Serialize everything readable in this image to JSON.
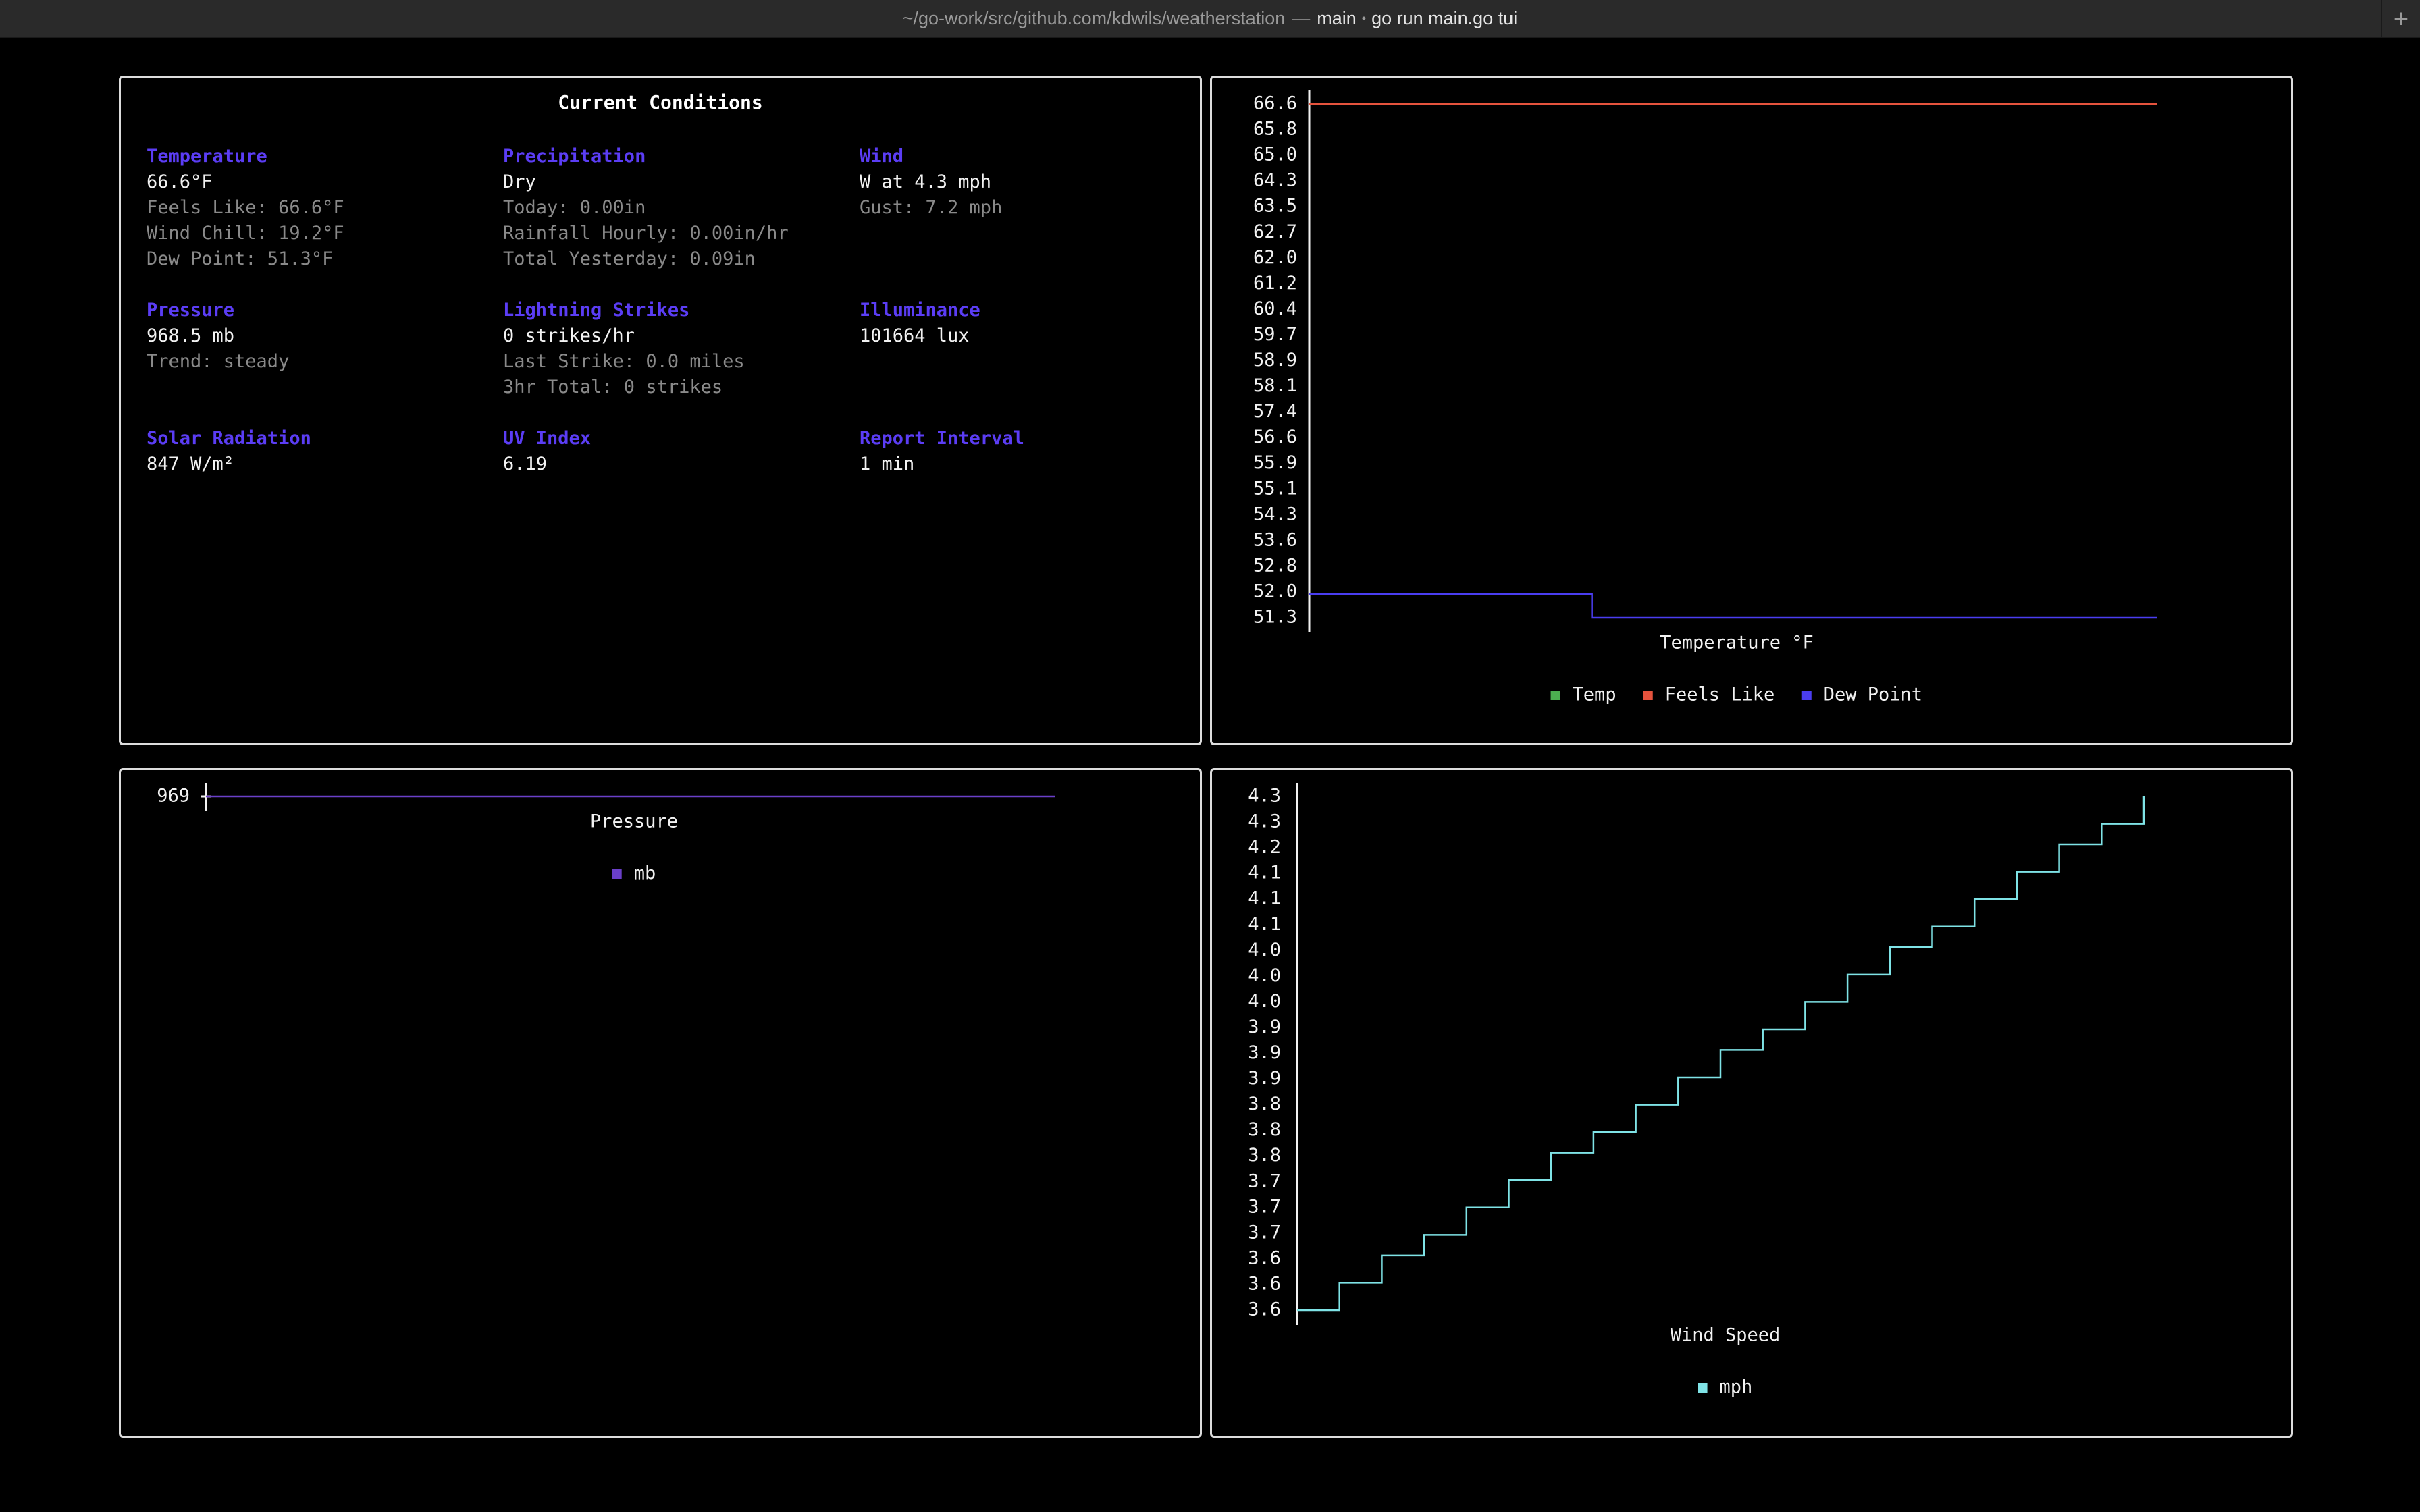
{
  "window": {
    "path": "~/go-work/src/github.com/kdwils/weatherstation",
    "separator": "—",
    "branch": "main",
    "dot": "•",
    "command": "go run main.go tui",
    "new_tab": "+"
  },
  "conditions": {
    "title": "Current Conditions",
    "cells": [
      {
        "heading": "Temperature",
        "value": "66.6°F",
        "subs": [
          "Feels Like: 66.6°F",
          "Wind Chill: 19.2°F",
          "Dew Point: 51.3°F"
        ]
      },
      {
        "heading": "Precipitation",
        "value": "Dry",
        "subs": [
          "Today: 0.00in",
          "Rainfall Hourly: 0.00in/hr",
          "Total Yesterday: 0.09in"
        ]
      },
      {
        "heading": "Wind",
        "value": "W at 4.3 mph",
        "subs": [
          "Gust: 7.2 mph"
        ]
      },
      {
        "heading": "Pressure",
        "value": "968.5 mb",
        "subs": [
          "Trend: steady"
        ]
      },
      {
        "heading": "Lightning Strikes",
        "value": "0 strikes/hr",
        "subs": [
          "Last Strike: 0.0 miles",
          "3hr Total: 0 strikes"
        ]
      },
      {
        "heading": "Illuminance",
        "value": "101664 lux",
        "subs": []
      },
      {
        "heading": "Solar Radiation",
        "value": "847 W/m²",
        "subs": []
      },
      {
        "heading": "UV Index",
        "value": "6.19",
        "subs": []
      },
      {
        "heading": "Report Interval",
        "value": "1 min",
        "subs": []
      }
    ]
  },
  "colors": {
    "heading": "#5b3df5",
    "temp": "#4caf50",
    "feels_like": "#e5533d",
    "dew_point": "#4a3df0",
    "pressure": "#6a3fc8",
    "wind": "#7fe3e6",
    "axis": "#f2f2f2"
  },
  "chart_data": [
    {
      "type": "line",
      "xlabel": "Temperature °F",
      "ylabel": "",
      "yticks": [
        "66.6",
        "65.8",
        "65.0",
        "64.3",
        "63.5",
        "62.7",
        "62.0",
        "61.2",
        "60.4",
        "59.7",
        "58.9",
        "58.1",
        "57.4",
        "56.6",
        "55.9",
        "55.1",
        "54.3",
        "53.6",
        "52.8",
        "52.0",
        "51.3"
      ],
      "ylim": [
        51.3,
        66.6
      ],
      "legend": [
        "Temp",
        "Feels Like",
        "Dew Point"
      ],
      "series": [
        {
          "name": "Temp",
          "color_key": "temp",
          "values": [
            66.6,
            66.6
          ]
        },
        {
          "name": "Feels Like",
          "color_key": "feels_like",
          "values": [
            66.6,
            66.6
          ]
        },
        {
          "name": "Dew Point",
          "color_key": "dew_point",
          "values": [
            52.0,
            52.0,
            52.0,
            51.3,
            51.3,
            51.3,
            51.3,
            51.3,
            51.3,
            51.3
          ]
        }
      ]
    },
    {
      "type": "line",
      "xlabel": "Pressure",
      "ylabel": "",
      "yticks": [
        "969"
      ],
      "ylim": [
        969,
        969
      ],
      "legend": [
        "mb"
      ],
      "series": [
        {
          "name": "mb",
          "color_key": "pressure",
          "values": [
            969,
            969
          ]
        }
      ]
    },
    {
      "type": "line",
      "xlabel": "Wind Speed",
      "ylabel": "",
      "yticks": [
        "4.3",
        "4.3",
        "4.2",
        "4.1",
        "4.1",
        "4.1",
        "4.0",
        "4.0",
        "4.0",
        "3.9",
        "3.9",
        "3.9",
        "3.8",
        "3.8",
        "3.8",
        "3.7",
        "3.7",
        "3.7",
        "3.6",
        "3.6",
        "3.6"
      ],
      "ylim": [
        3.55,
        4.3
      ],
      "legend": [
        "mph"
      ],
      "series": [
        {
          "name": "mph",
          "color_key": "wind",
          "values": [
            3.55,
            3.59,
            3.63,
            3.66,
            3.7,
            3.74,
            3.78,
            3.81,
            3.85,
            3.89,
            3.93,
            3.96,
            4.0,
            4.04,
            4.08,
            4.11,
            4.15,
            4.19,
            4.23,
            4.26,
            4.3
          ]
        }
      ]
    }
  ]
}
